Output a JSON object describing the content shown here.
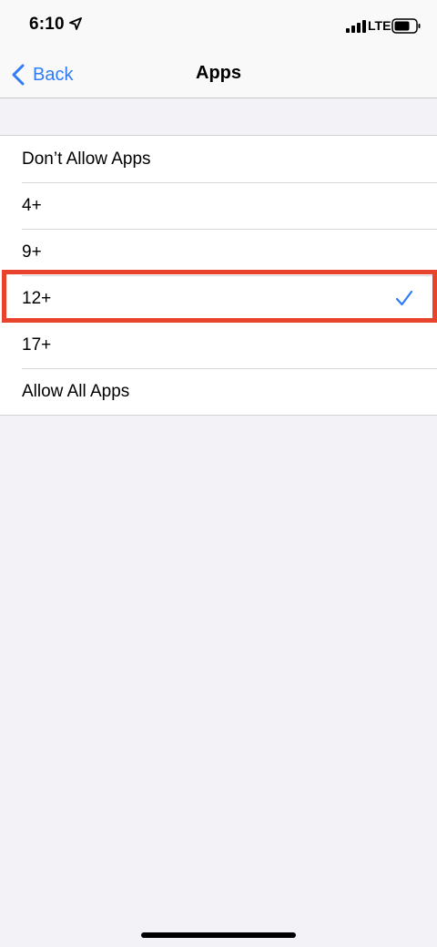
{
  "status_bar": {
    "time": "6:10",
    "carrier": "LTE",
    "icons": [
      "location-arrow-icon",
      "cellular-signal-icon",
      "battery-icon"
    ]
  },
  "nav": {
    "back_label": "Back",
    "title": "Apps"
  },
  "options": [
    {
      "label": "Don’t Allow Apps",
      "selected": false
    },
    {
      "label": "4+",
      "selected": false
    },
    {
      "label": "9+",
      "selected": false
    },
    {
      "label": "12+",
      "selected": true
    },
    {
      "label": "17+",
      "selected": false
    },
    {
      "label": "Allow All Apps",
      "selected": false
    }
  ],
  "colors": {
    "accent": "#2f7cf6",
    "highlight": "#e8432d",
    "background": "#f2f2f7"
  }
}
